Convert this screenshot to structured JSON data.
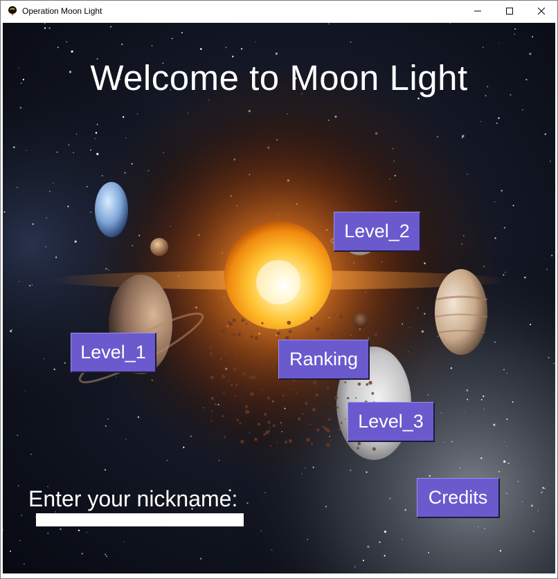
{
  "window": {
    "title": "Operation Moon Light",
    "icons": [
      "app-icon",
      "minimize-icon",
      "maximize-icon",
      "close-icon"
    ]
  },
  "game": {
    "headline": "Welcome to Moon Light",
    "buttons": {
      "level_1": "Level_1",
      "level_2": "Level_2",
      "level_3": "Level_3",
      "ranking": "Ranking",
      "credits": "Credits"
    },
    "nickname": {
      "label": "Enter your nickname:",
      "value": ""
    },
    "colors": {
      "button_fill": "#6a5acd",
      "button_text": "#ffffff",
      "headline_text": "#ffffff",
      "background": "#0b0f19"
    }
  }
}
